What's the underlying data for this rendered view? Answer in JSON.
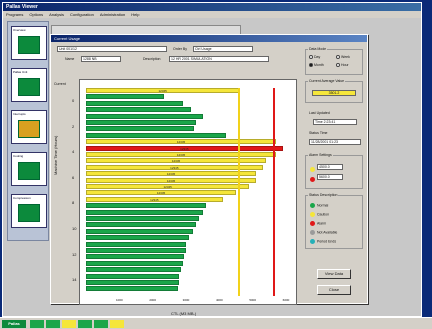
{
  "main": {
    "title": "Pallas Viewer",
    "menu": [
      "Programs",
      "Options",
      "Analysis",
      "Configuration",
      "Administration",
      "Help"
    ]
  },
  "left_tiles": [
    "Overview",
    "Pallas Unit",
    "Interrupts",
    "Cooling",
    "Compression"
  ],
  "dialog": {
    "title": "Current Usage",
    "selector_left": "Unit 001/12",
    "selector_right_label": "Order By",
    "selector_right": "Ctrl Usage",
    "name_label": "Name",
    "name_value": "1288 NB",
    "description_label": "Description",
    "description_value": "12 HR 2001  SIMULATION"
  },
  "chart_data": {
    "type": "bar",
    "orientation": "horizontal",
    "ylabel": "Machine Time (Hours)",
    "xlabel": "CTL (M3 MB-)",
    "top_label": "Current",
    "y_ticks": [
      "0",
      "2",
      "4",
      "6",
      "8",
      "10",
      "12",
      "14"
    ],
    "x_ticks": [
      "1000",
      "2000",
      "3000",
      "4000",
      "5000",
      "6000"
    ],
    "xlim": [
      0,
      6000
    ],
    "bars": [
      {
        "value": 4600,
        "status": "yellow",
        "label": "12345"
      },
      {
        "value": 2350,
        "status": "green",
        "label": ""
      },
      {
        "value": 2900,
        "status": "green",
        "label": ""
      },
      {
        "value": 3150,
        "status": "green",
        "label": ""
      },
      {
        "value": 3500,
        "status": "green",
        "label": ""
      },
      {
        "value": 3300,
        "status": "green",
        "label": ""
      },
      {
        "value": 3250,
        "status": "green",
        "label": ""
      },
      {
        "value": 4200,
        "status": "green",
        "label": ""
      },
      {
        "value": 5700,
        "status": "yellow",
        "label": "12345"
      },
      {
        "value": 5900,
        "status": "red",
        "label": "12345"
      },
      {
        "value": 5700,
        "status": "yellow",
        "label": "12345"
      },
      {
        "value": 5400,
        "status": "yellow",
        "label": "12345"
      },
      {
        "value": 5300,
        "status": "yellow",
        "label": "12345"
      },
      {
        "value": 5100,
        "status": "yellow",
        "label": "12345"
      },
      {
        "value": 5100,
        "status": "yellow",
        "label": "12345"
      },
      {
        "value": 4900,
        "status": "yellow",
        "label": "12345"
      },
      {
        "value": 4500,
        "status": "yellow",
        "label": "12345"
      },
      {
        "value": 4100,
        "status": "yellow",
        "label": "12345"
      },
      {
        "value": 3600,
        "status": "green",
        "label": ""
      },
      {
        "value": 3500,
        "status": "green",
        "label": ""
      },
      {
        "value": 3400,
        "status": "green",
        "label": ""
      },
      {
        "value": 3300,
        "status": "green",
        "label": ""
      },
      {
        "value": 3200,
        "status": "green",
        "label": ""
      },
      {
        "value": 3100,
        "status": "green",
        "label": ""
      },
      {
        "value": 3000,
        "status": "green",
        "label": ""
      },
      {
        "value": 3000,
        "status": "green",
        "label": ""
      },
      {
        "value": 2950,
        "status": "green",
        "label": ""
      },
      {
        "value": 2900,
        "status": "green",
        "label": ""
      },
      {
        "value": 2850,
        "status": "green",
        "label": ""
      },
      {
        "value": 2800,
        "status": "green",
        "label": ""
      },
      {
        "value": 2800,
        "status": "green",
        "label": ""
      },
      {
        "value": 2750,
        "status": "green",
        "label": ""
      }
    ],
    "thresholds": [
      {
        "value": 4550,
        "color": "#f2d21a"
      },
      {
        "value": 5600,
        "color": "#e01818"
      }
    ]
  },
  "colors": {
    "green": "#1aa64a",
    "yellow": "#f5e63a",
    "red": "#e01818",
    "gray": "#9a9a9a",
    "teal": "#25b0b8"
  },
  "right": {
    "display_title": "Data Mode",
    "display_opts": [
      "Day",
      "Week",
      "Month",
      "Hour"
    ],
    "current_title": "Current Average Value",
    "current_value": "3501.2",
    "updated_label": "Last Updated",
    "updated_value": "Time 2:23:41",
    "status_label": "Status Time",
    "status_value": "11/28/2001 01:23",
    "warn_title": "Alarm Settings",
    "warn_items": [
      {
        "color": "yellow",
        "value": "4500.0"
      },
      {
        "color": "red",
        "value": "5600.0"
      }
    ],
    "legend_title": "Status Description",
    "legend_items": [
      {
        "color": "green",
        "text": "Normal"
      },
      {
        "color": "yellow",
        "text": "Caution"
      },
      {
        "color": "red",
        "text": "Alarm"
      },
      {
        "color": "gray",
        "text": "Not Available"
      },
      {
        "color": "teal",
        "text": "Period Ends"
      }
    ],
    "btn_view": "View Data",
    "btn_close": "Close"
  },
  "taskbar": {
    "start": "Pallas"
  }
}
